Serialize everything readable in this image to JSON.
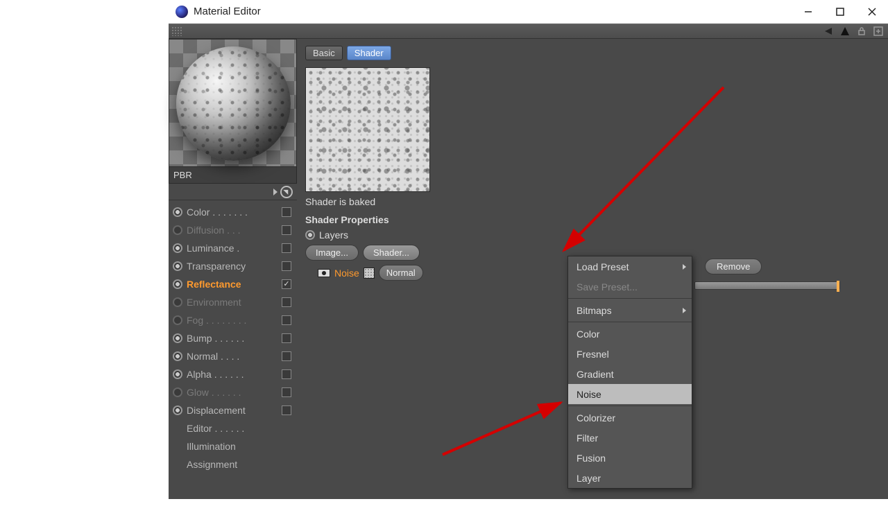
{
  "window": {
    "title": "Material Editor"
  },
  "material": {
    "name": "PBR"
  },
  "channels": [
    {
      "label": "Color . . . . . . .",
      "radio": true,
      "disabled": false,
      "checkbox": true,
      "checked": false,
      "active": false
    },
    {
      "label": "Diffusion . . .",
      "radio": false,
      "disabled": true,
      "checkbox": true,
      "checked": false,
      "active": false
    },
    {
      "label": "Luminance .",
      "radio": true,
      "disabled": false,
      "checkbox": true,
      "checked": false,
      "active": false
    },
    {
      "label": "Transparency",
      "radio": true,
      "disabled": false,
      "checkbox": true,
      "checked": false,
      "active": false
    },
    {
      "label": "Reflectance",
      "radio": true,
      "disabled": false,
      "checkbox": true,
      "checked": true,
      "active": true
    },
    {
      "label": "Environment",
      "radio": false,
      "disabled": true,
      "checkbox": true,
      "checked": false,
      "active": false
    },
    {
      "label": "Fog . . . . . . . .",
      "radio": false,
      "disabled": true,
      "checkbox": true,
      "checked": false,
      "active": false
    },
    {
      "label": "Bump . . . . . .",
      "radio": true,
      "disabled": false,
      "checkbox": true,
      "checked": false,
      "active": false
    },
    {
      "label": "Normal . . . .",
      "radio": true,
      "disabled": false,
      "checkbox": true,
      "checked": false,
      "active": false
    },
    {
      "label": "Alpha . . . . . .",
      "radio": true,
      "disabled": false,
      "checkbox": true,
      "checked": false,
      "active": false
    },
    {
      "label": "Glow . . . . . .",
      "radio": false,
      "disabled": true,
      "checkbox": true,
      "checked": false,
      "active": false
    },
    {
      "label": "Displacement",
      "radio": true,
      "disabled": false,
      "checkbox": true,
      "checked": false,
      "active": false
    },
    {
      "label": "Editor . . . . . .",
      "radio": false,
      "disabled": false,
      "checkbox": false,
      "checked": false,
      "active": false
    },
    {
      "label": "Illumination",
      "radio": false,
      "disabled": false,
      "checkbox": false,
      "checked": false,
      "active": false
    },
    {
      "label": "Assignment",
      "radio": false,
      "disabled": false,
      "checkbox": false,
      "checked": false,
      "active": false
    }
  ],
  "tabs": {
    "basic": "Basic",
    "shader": "Shader"
  },
  "shader": {
    "baked": "Shader is baked",
    "properties_title": "Shader Properties",
    "layers_label": "Layers",
    "image_btn": "Image...",
    "shader_btn": "Shader...",
    "remove_btn": "Remove",
    "entry_label": "Noise",
    "blend_mode": "Normal"
  },
  "popup": {
    "items": [
      {
        "label": "Load Preset",
        "sub": true,
        "disabled": false
      },
      {
        "label": "Save Preset...",
        "sub": false,
        "disabled": true
      },
      {
        "sep": true
      },
      {
        "label": "Bitmaps",
        "sub": true,
        "disabled": false
      },
      {
        "sep": true
      },
      {
        "label": "Color",
        "disabled": false
      },
      {
        "label": "Fresnel",
        "disabled": false
      },
      {
        "label": "Gradient",
        "disabled": false
      },
      {
        "label": "Noise",
        "disabled": false,
        "highlight": true
      },
      {
        "sep": true
      },
      {
        "label": "Colorizer",
        "disabled": false
      },
      {
        "label": "Filter",
        "disabled": false
      },
      {
        "label": "Fusion",
        "disabled": false
      },
      {
        "label": "Layer",
        "disabled": false
      }
    ]
  }
}
